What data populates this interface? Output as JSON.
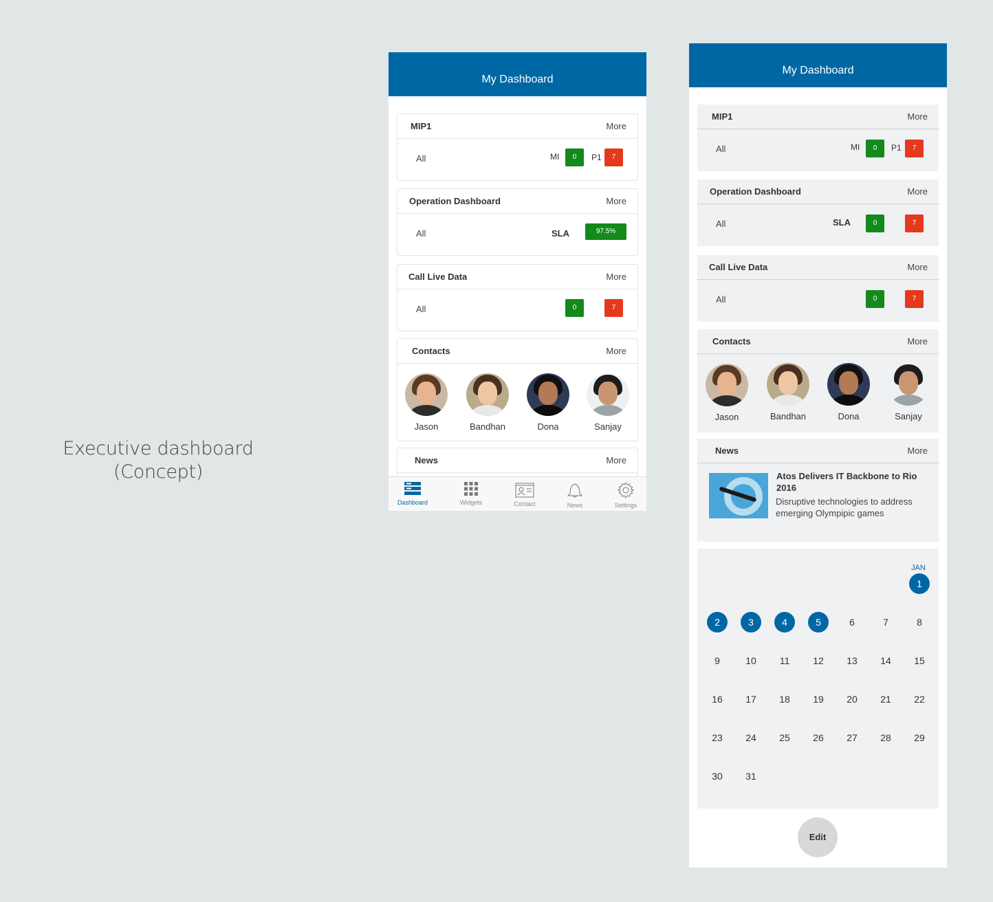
{
  "concept": {
    "line1": "Executive dashboard",
    "line2": "(Concept)"
  },
  "app": {
    "title": "My Dashboard"
  },
  "cards": {
    "more_label": "More",
    "all_label": "All",
    "mip1": {
      "title": "MIP1",
      "mi_label": "MI",
      "mi_value": "0",
      "p1_label": "P1",
      "p1_value": "7"
    },
    "operation": {
      "title": "Operation Dashboard",
      "sla_label": "SLA",
      "sla_value": "97.5%",
      "sla_green": "0",
      "sla_red": "7"
    },
    "call": {
      "title": "Call Live Data",
      "green_value": "0",
      "red_value": "7"
    },
    "contacts": {
      "title": "Contacts",
      "items": [
        {
          "name": "Jason"
        },
        {
          "name": "Bandhan"
        },
        {
          "name": "Dona"
        },
        {
          "name": "Sanjay"
        }
      ]
    },
    "news": {
      "title": "News",
      "headline": "Atos Delivers IT Backbone to Rio 2016",
      "summary": "Disruptive technologies to address emerging Olympipic games"
    }
  },
  "tabs": [
    {
      "label": "Dashboard",
      "icon": "dashboard-icon"
    },
    {
      "label": "Widgets",
      "icon": "grid-icon"
    },
    {
      "label": "Contact",
      "icon": "contact-card-icon"
    },
    {
      "label": "News",
      "icon": "bell-icon"
    },
    {
      "label": "Settings",
      "icon": "gear-icon"
    }
  ],
  "calendar": {
    "month": "JAN",
    "selected_days": [
      1,
      2,
      3,
      4,
      5
    ],
    "days": [
      "1",
      "2",
      "3",
      "4",
      "5",
      "6",
      "7",
      "8",
      "9",
      "10",
      "11",
      "12",
      "13",
      "14",
      "15",
      "16",
      "17",
      "18",
      "19",
      "20",
      "21",
      "22",
      "23",
      "24",
      "25",
      "26",
      "27",
      "28",
      "29",
      "30",
      "31"
    ]
  },
  "edit_label": "Edit",
  "colors": {
    "brand": "#0067a5",
    "green": "#138a1b",
    "red": "#e5391d",
    "background": "#e1e6e6"
  }
}
